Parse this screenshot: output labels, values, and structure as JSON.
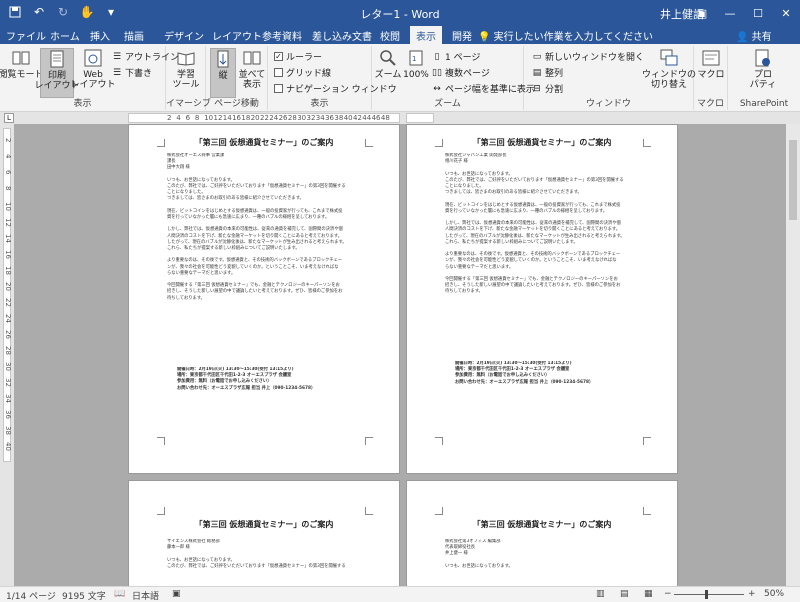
{
  "title_bar": {
    "document_title": "レター1 - Word",
    "user": "井上健語"
  },
  "menu_tabs": [
    "ファイル",
    "ホーム",
    "挿入",
    "描画",
    "デザイン",
    "レイアウト",
    "参考資料",
    "差し込み文書",
    "校閲",
    "表示",
    "開発"
  ],
  "active_tab": "表示",
  "tell_me": "実行したい作業を入力してください",
  "share": "共有",
  "ribbon": {
    "views": {
      "read_mode": "閲覧モード",
      "print_layout": "印刷\nレイアウト",
      "web_layout": "Web\nレイアウト",
      "outline": "アウトライン",
      "draft": "下書き",
      "group": "表示"
    },
    "immersive": {
      "learning_tools": "学習\nツール",
      "group": "イマーシブ"
    },
    "page_movement": {
      "vertical": "縦",
      "side_by_side": "並べて\n表示",
      "group": "ページ移動"
    },
    "show": {
      "ruler": "ルーラー",
      "gridlines": "グリッド線",
      "nav_pane": "ナビゲーション ウィンドウ",
      "group": "表示"
    },
    "zoom": {
      "zoom": "ズーム",
      "hundred": "100%",
      "one_page": "1 ページ",
      "multiple_pages": "複数ページ",
      "page_width": "ページ幅を基準に表示",
      "group": "ズーム"
    },
    "window": {
      "new_window": "新しいウィンドウを開く",
      "arrange": "整列",
      "split": "分割",
      "switch": "ウィンドウの\n切り替え",
      "group": "ウィンドウ"
    },
    "macros": {
      "macros": "マクロ",
      "group": "マクロ"
    },
    "sharepoint": {
      "properties": "プロ\nパティ",
      "group": "SharePoint"
    }
  },
  "ruler_numbers": [
    "2",
    "4",
    "6",
    "8",
    "10",
    "12",
    "14",
    "16",
    "18",
    "20",
    "22",
    "24",
    "26",
    "28",
    "30",
    "32",
    "34",
    "36",
    "38",
    "40",
    "42",
    "44",
    "46",
    "48"
  ],
  "vertical_ruler_numbers": [
    "2",
    "4",
    "6",
    "8",
    "10",
    "12",
    "14",
    "16",
    "18",
    "20",
    "22",
    "24",
    "26",
    "28",
    "30",
    "32",
    "34",
    "36",
    "38",
    "40"
  ],
  "letters": [
    {
      "title": "「第三回 仮想通貨セミナー」のご案内",
      "lines": [
        "株式会社オーエス商事 営業課",
        "課長",
        "田中大翔 様",
        "",
        "いつも、お世話になっております。",
        "このたび、弊社では、ご好評をいただいております「仮想通貨セミナー」の第3回を開催する",
        "ことになりました。",
        "つきましては、皆さまのお取引のある皆様に紹介させていただきます。",
        "",
        "現在、ビットコインをはじめとする仮想通貨は、一般の投資家が行っても、これまで株式投",
        "資を行っていなかった層にも急速に広まり、一種のバブルの様相を呈しております。",
        "",
        "しかし、弊社では、仮想通貨の本来の可能性は、従来の通貨を補完して、国際間の決済や個",
        "人間決済のコストを下げ、新たな金融マーケットを切り開くことにあると考えております。",
        "したがって、現在のバブルが沈静化後は、新たなマーケットが生み出されると考えられます。",
        "これら、私たちが提案する新しい枠組みについてご説明いたします。",
        "",
        "より重要なのは、その後です。仮想通貨と、その技術的バックボーンであるブロックチェー",
        "ンが、我々の社会を可能性どう変貌していくのか。ということこそ、いま考えなければな",
        "らない重要なテーマだと思います。",
        "",
        "今回開催する「第三回 仮想通貨セミナー」でも、金融とテクノロジーのキーパーソンをお",
        "招きし、そうした新しい展望の中で議論したいと考えております。ぜひ、皆様のご参加をお",
        "待ちしております。"
      ],
      "details": [
        "開催日時：2月19日(火) 13:30～15:30(受付 13:15より)",
        "場所：東京都千代田区千代田1-2-3 オーエスプラザ 会議室",
        "参加費用：無料（お電話でお申し込みください）",
        "お問い合わせ先：オーエスプラザ広報 担当 井上（090-1234-5678）"
      ]
    },
    {
      "title": "「第三回 仮想通貨セミナー」のご案内",
      "lines": [
        "株式会社ジャパン工業 開発部長",
        "相川花子 様",
        "",
        "いつも、お世話になっております。",
        "このたび、弊社では、ご好評をいただいております「仮想通貨セミナー」の第3回を開催する",
        "ことになりました。",
        "つきましては、皆さまのお取引のある皆様に紹介させていただきます。",
        "",
        "現在、ビットコインをはじめとする仮想通貨は、一般の投資家が行っても、これまで株式投",
        "資を行っていなかった層にも急速に広まり、一種のバブルの様相を呈しております。",
        "",
        "しかし、弊社では、仮想通貨の本来の可能性は、従来の通貨を補完して、国際間の決済や個",
        "人間決済のコストを下げ、新たな金融マーケットを切り開くことにあると考えております。",
        "したがって、現在のバブルが沈静化後は、新たなマーケットが生み出されると考えられます。",
        "これら、私たちが提案する新しい枠組みについてご説明いたします。",
        "",
        "より重要なのは、その後です。仮想通貨と、その技術的バックボーンであるブロックチェー",
        "ンが、我々の社会を可能性どう変貌していくのか。ということこそ、いま考えなければな",
        "らない重要なテーマだと思います。",
        "",
        "今回開催する「第三回 仮想通貨セミナー」でも、金融とテクノロジーのキーパーソンをお",
        "招きし、そうした新しい展望の中で議論したいと考えております。ぜひ、皆様のご参加をお",
        "待ちしております。"
      ],
      "details": [
        "開催日時：2月19日(火) 13:30～15:30(受付 13:15より)",
        "場所：東京都千代田区千代田1-2-3 オーエスプラザ 会議室",
        "参加費用：無料（お電話でお申し込みください）",
        "お問い合わせ先：オーエスプラザ広報 担当 井上（090-1234-5678）"
      ]
    },
    {
      "title": "「第三回 仮想通貨セミナー」のご案内",
      "lines": [
        "サイエンス株式会社 総務部",
        "藤本一郎 様",
        "",
        "いつも、お世話になっております。",
        "このたび、弊社では、ご好評をいただいております「仮想通貨セミナー」の第3回を開催する"
      ],
      "details": []
    },
    {
      "title": "「第三回 仮想通貨セミナー」のご案内",
      "lines": [
        "株式会社第3オフィス 編集部",
        "代表取締役社長",
        "井上健一 様",
        "",
        "いつも、お世話になっております。"
      ],
      "details": []
    }
  ],
  "status": {
    "page": "1/14 ページ",
    "words": "9195 文字",
    "language": "日本語",
    "zoom": "50%",
    "zoom_level_percent": 50
  }
}
